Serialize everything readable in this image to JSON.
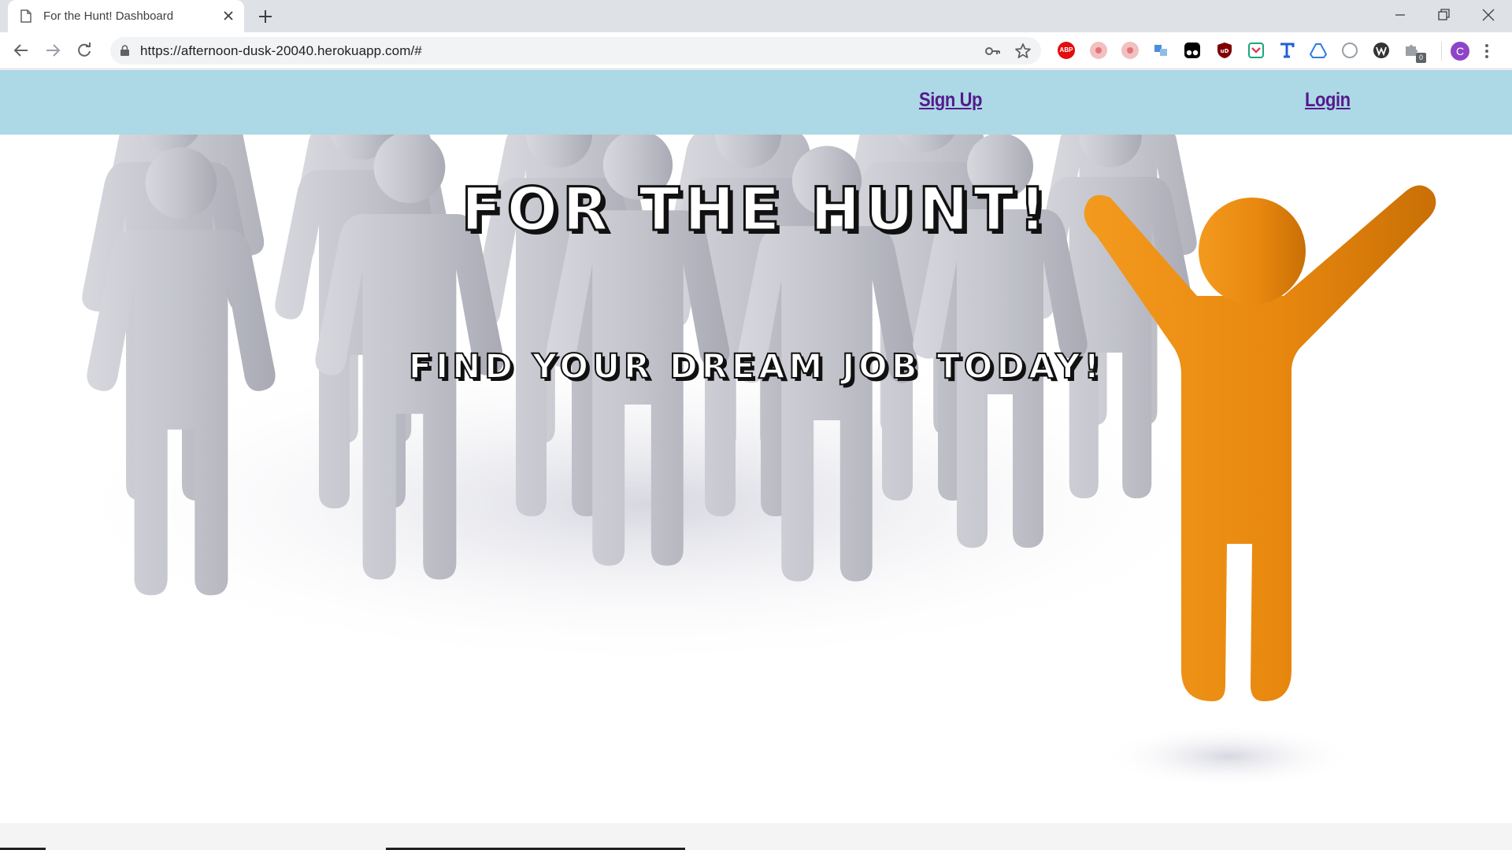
{
  "browser": {
    "tab_title": "For the Hunt! Dashboard",
    "url": "https://afternoon-dusk-20040.herokuapp.com/#",
    "profile_initial": "C",
    "extensions": [
      {
        "icon": "adblock-plus-icon",
        "color": "#e40d0d",
        "label": "ABP"
      },
      {
        "icon": "red-dot-extension-icon",
        "color": "#e57373"
      },
      {
        "icon": "red-dot-extension-icon",
        "color": "#e57373"
      },
      {
        "icon": "translate-extension-icon",
        "color": "#4a90d9"
      },
      {
        "icon": "tampermonkey-icon",
        "color": "#000000"
      },
      {
        "icon": "ublock-origin-icon",
        "color": "#800000",
        "label": "uD"
      },
      {
        "icon": "pocket-icon",
        "color": "#1aa879"
      },
      {
        "icon": "typography-extension-icon",
        "color": "#1f5fd9"
      },
      {
        "icon": "google-drive-icon",
        "color": "#2d7be5"
      },
      {
        "icon": "grey-circle-extension-icon",
        "color": "#9aa0a6"
      },
      {
        "icon": "w-extension-icon",
        "color": "#333333"
      },
      {
        "icon": "puzzle-extension-icon",
        "color": "#5f6368",
        "badge": "0"
      }
    ]
  },
  "site": {
    "nav": {
      "signup_label": "Sign Up",
      "login_label": "Login"
    },
    "hero": {
      "title": "For the Hunt!",
      "subtitle": "Find your dream job today!"
    }
  },
  "colors": {
    "nav_bg": "#add8e6",
    "link": "#551a8b",
    "figure_grey": "#c3c4cc",
    "figure_orange": "#e8880f"
  }
}
